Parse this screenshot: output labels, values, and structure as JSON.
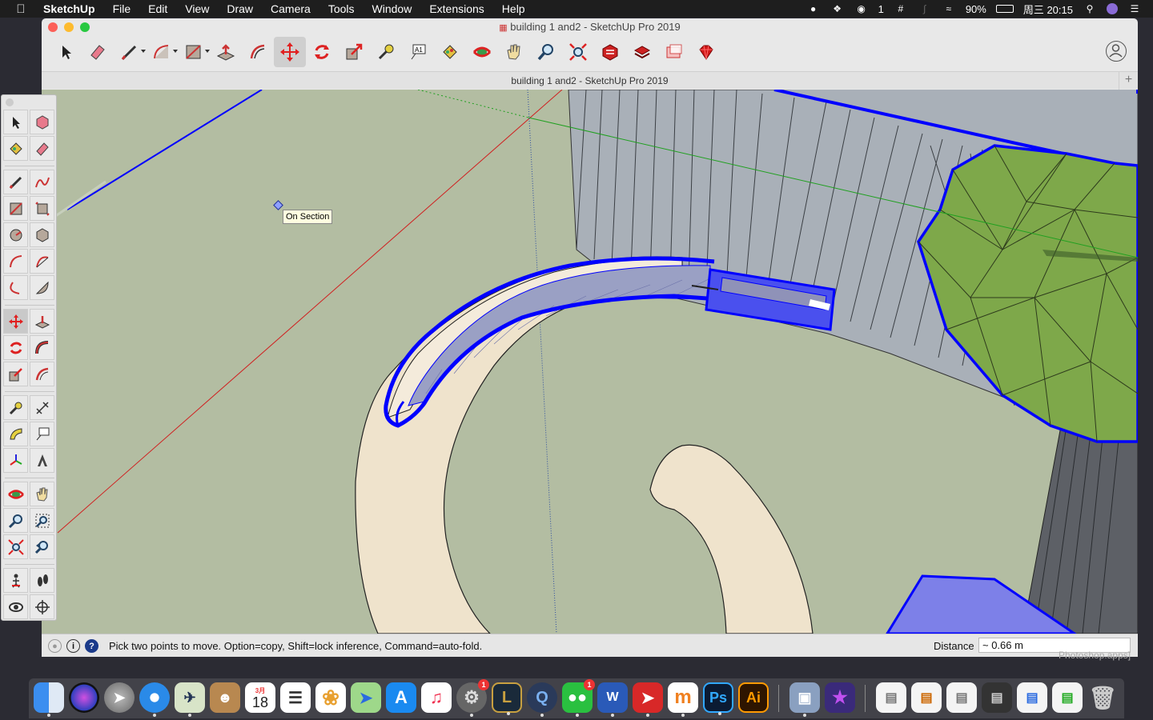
{
  "menubar": {
    "apple_icon": "apple-icon",
    "items": [
      "SketchUp",
      "File",
      "Edit",
      "View",
      "Draw",
      "Camera",
      "Tools",
      "Window",
      "Extensions",
      "Help"
    ],
    "status": {
      "wechat_count": "1",
      "battery": "90%",
      "clock": "周三 20:15"
    }
  },
  "window": {
    "title": "building 1 and2 - SketchUp Pro 2019",
    "tab_title": "building 1 and2 - SketchUp Pro 2019",
    "tab_add": "+"
  },
  "toolbar": {
    "tools": [
      "select",
      "eraser",
      "line",
      "arc",
      "rectangle",
      "push-pull",
      "offset",
      "move",
      "rotate",
      "scale",
      "tape-measure",
      "text",
      "paint-bucket",
      "orbit",
      "pan",
      "zoom",
      "zoom-extents",
      "warehouse",
      "extension-warehouse",
      "layout",
      "ruby"
    ],
    "active_tool": "move"
  },
  "viewport": {
    "tooltip": "On Section"
  },
  "statusbar": {
    "message": "Pick two points to move.  Option=copy, Shift=lock inference, Command=auto-fold.",
    "distance_label": "Distance",
    "distance_value": "~ 0.66 m"
  },
  "dock": {
    "calendar_month": "3月",
    "calendar_day": "18",
    "wechat_badge": "1",
    "settings_badge": "1",
    "photoshop_label": "Ps",
    "illustrator_label": "Ai",
    "word_label": "W"
  },
  "background_text": "Photoshop.apps]",
  "colors": {
    "viewport_bg": "#b3bda2",
    "selection_blue": "#0000ff",
    "tube_fill": "#efe3cc",
    "green_mesh": "#7ea84a",
    "wall_fill": "#a9b0b8"
  }
}
